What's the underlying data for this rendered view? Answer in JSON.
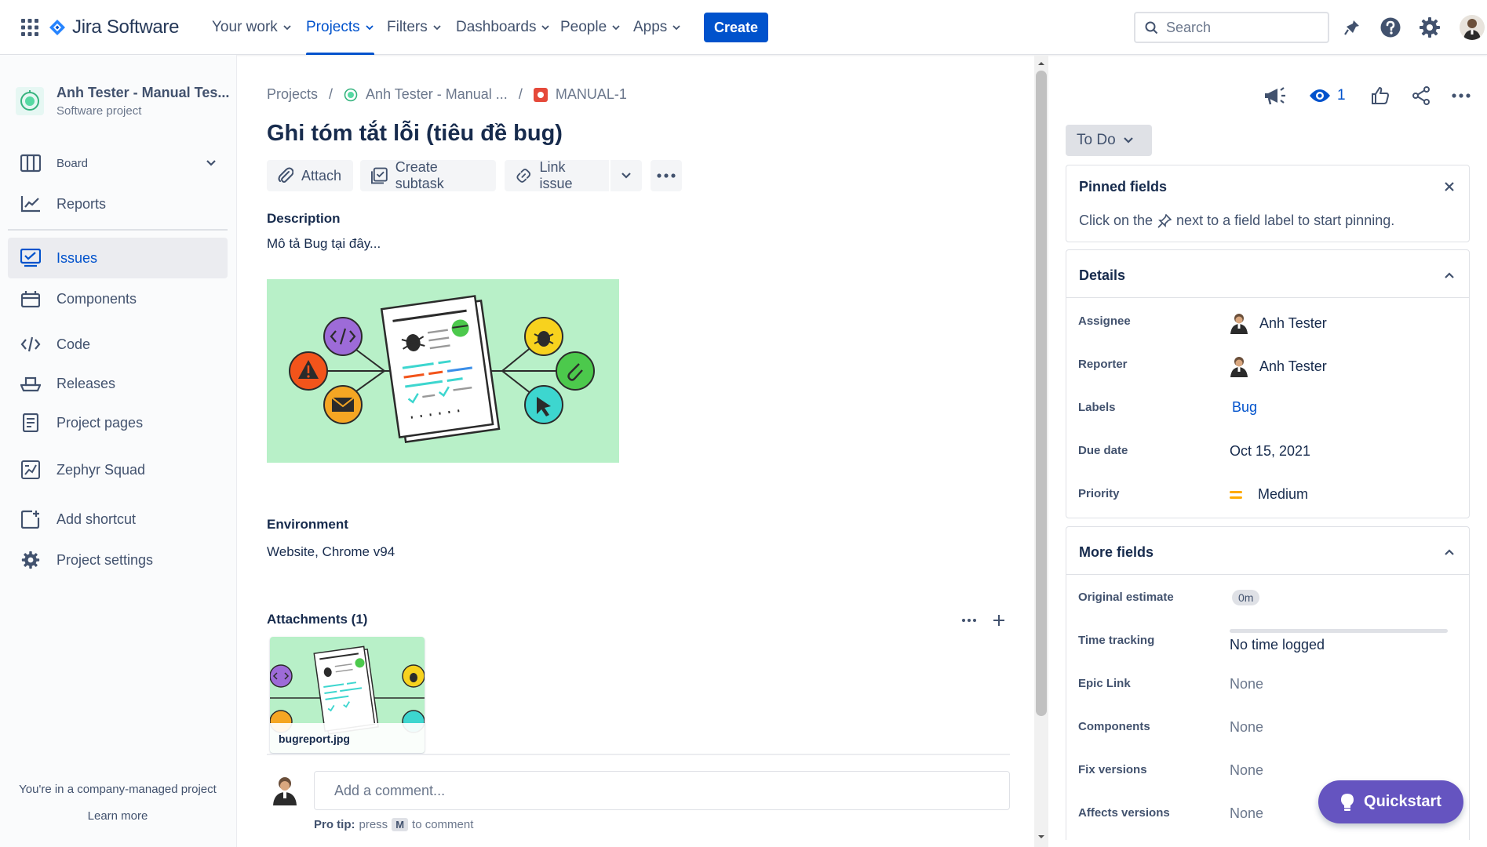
{
  "topnav": {
    "brand": "Jira Software",
    "items": [
      {
        "label": "Your work"
      },
      {
        "label": "Projects"
      },
      {
        "label": "Filters"
      },
      {
        "label": "Dashboards"
      },
      {
        "label": "People"
      },
      {
        "label": "Apps"
      }
    ],
    "create_label": "Create",
    "search_placeholder": "Search"
  },
  "sidebar": {
    "project_name": "Anh Tester - Manual Tes...",
    "project_type": "Software project",
    "items": [
      {
        "label": "Board"
      },
      {
        "label": "Reports"
      },
      {
        "label": "Issues"
      },
      {
        "label": "Components"
      },
      {
        "label": "Code"
      },
      {
        "label": "Releases"
      },
      {
        "label": "Project pages"
      },
      {
        "label": "Zephyr Squad"
      },
      {
        "label": "Add shortcut"
      },
      {
        "label": "Project settings"
      }
    ],
    "footer_text": "You're in a company-managed project",
    "footer_link": "Learn more"
  },
  "breadcrumb": {
    "projects": "Projects",
    "project": "Anh Tester - Manual ...",
    "issue_key": "MANUAL-1"
  },
  "issue": {
    "title": "Ghi tóm tắt lỗi (tiêu đề bug)",
    "toolbar": {
      "attach": "Attach",
      "create_subtask": "Create subtask",
      "link_issue": "Link issue"
    },
    "description_label": "Description",
    "description_text": "Mô tả Bug tại đây...",
    "environment_label": "Environment",
    "environment_text": "Website, Chrome v94",
    "attachments_label": "Attachments (1)",
    "attachment_name": "bugreport.jpg",
    "comment_placeholder": "Add a comment...",
    "protip_label": "Pro tip:",
    "protip_press": "press",
    "protip_key": "M",
    "protip_suffix": "to comment"
  },
  "right": {
    "watch_count": "1",
    "status": "To Do",
    "pinned_title": "Pinned fields",
    "pinned_text_before": "Click on the",
    "pinned_text_after": "next to a field label to start pinning.",
    "details_title": "Details",
    "details": {
      "assignee_label": "Assignee",
      "assignee": "Anh Tester",
      "reporter_label": "Reporter",
      "reporter": "Anh Tester",
      "labels_label": "Labels",
      "labels": "Bug",
      "due_label": "Due date",
      "due": "Oct 15, 2021",
      "priority_label": "Priority",
      "priority": "Medium"
    },
    "more_title": "More fields",
    "more": {
      "orig_label": "Original estimate",
      "orig": "0m",
      "tt_label": "Time tracking",
      "tt": "No time logged",
      "epic_label": "Epic Link",
      "epic": "None",
      "comp_label": "Components",
      "comp": "None",
      "fix_label": "Fix versions",
      "fix": "None",
      "aff_label": "Affects versions",
      "aff": "None"
    },
    "quickstart": "Quickstart"
  },
  "colors": {
    "brand_blue": "#0052cc",
    "quickstart_purple": "#6554c0",
    "priority_medium": "#ffab00",
    "issue_type_bug": "#e5493a"
  }
}
